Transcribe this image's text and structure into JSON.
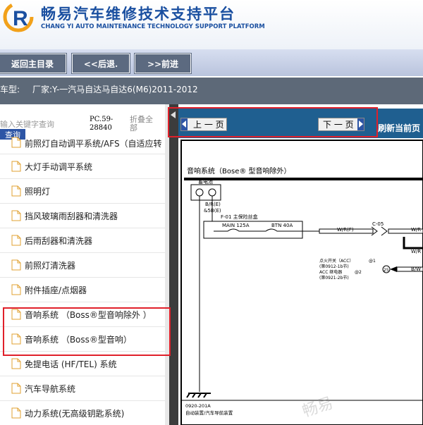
{
  "header": {
    "title": "畅易汽车维修技术支持平台",
    "subtitle": "CHANG YI AUTO MAINTENANCE TECHNOLOGY SUPPORT PLATFORM"
  },
  "nav": {
    "home": "返回主目录",
    "back": "<<后退.",
    "forward": ">>前进"
  },
  "car": {
    "label": "车型:",
    "value": "厂家:Y-一汽马自达马自达6(M6)2011-2012"
  },
  "sidebar": {
    "search_placeholder": "输入关键字查询",
    "search_button": "查询",
    "pc_label": "PC.59-\n28840",
    "collapse": "折叠全\n部",
    "items": [
      "前照灯自动调平系统/AFS（自适应转",
      "大灯手动调平系统",
      "照明灯",
      "挡风玻璃雨刮器和清洗器",
      "后雨刮器和清洗器",
      "前照灯清洗器",
      "附件插座/点烟器",
      "音响系统 （Boss®型音响除外 ）",
      "音响系统 （Boss®型音响）",
      "免提电话 (HF/TEL) 系统",
      "汽车导航系统",
      "动力系统(无高级钥匙系统)"
    ]
  },
  "viewer": {
    "prev": "上 一 页",
    "next": "下 一 页",
    "refresh": "刷新当前页",
    "diagram": {
      "title": "音响系统（Bose® 型音响除外）",
      "battery": "蓄电池",
      "wire_br": "B/R(E)",
      "wire_5br": "&5B(E)",
      "fuse_box": "F-01 主保险丝盒",
      "main_fuse": "MAIN 125A",
      "btn_fuse": "BTN 40A",
      "wire_wr1": "W/R(F)",
      "connector": "C-05",
      "wire_wr2": "W/R",
      "wire_wr3": "W/R",
      "acc_switch": "点火开关（ACC）",
      "acc_ref1": "(第0912-1b节)",
      "acc_relay": "ACC 继电器",
      "acc_ref2": "(第0921-2b节)",
      "at1": "@1",
      "at2": "@2",
      "num25": "25",
      "wire_bw": "B/W",
      "page_code": "0920-201A",
      "page_caption": "自动装置/汽车导航装置"
    }
  },
  "watermark": "畅易"
}
